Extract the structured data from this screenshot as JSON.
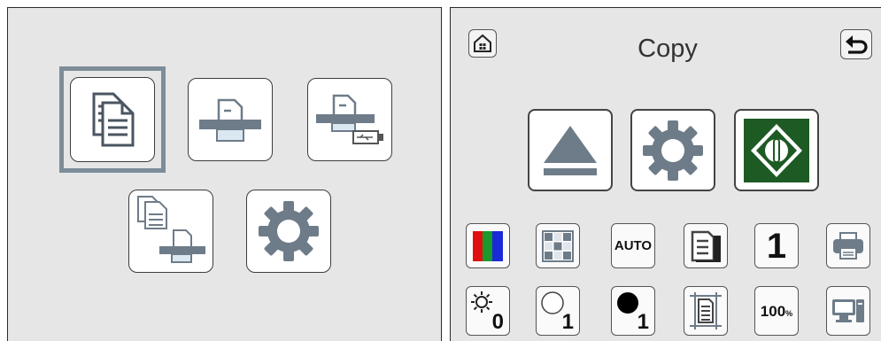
{
  "copy_screen": {
    "title": "Copy",
    "copies_value": "1",
    "color_mode_auto_label": "AUTO",
    "brightness_value": "0",
    "lightness_value": "1",
    "darkness_value": "1",
    "zoom_value": "100",
    "zoom_unit": "%"
  },
  "colors": {
    "panel_bg": "#e6e6e6",
    "selection_frame": "#7d8d99",
    "start_green": "#1e5a24",
    "icon_gray": "#6e7c89"
  },
  "icons": {
    "home": "home-icon",
    "back": "back-arrow-icon",
    "eject": "eject-icon",
    "settings": "gear-icon",
    "start": "start-icon",
    "color": "rgb-bars-icon",
    "layout": "grid-icon",
    "print": "printer-icon",
    "pc": "pc-icon"
  }
}
